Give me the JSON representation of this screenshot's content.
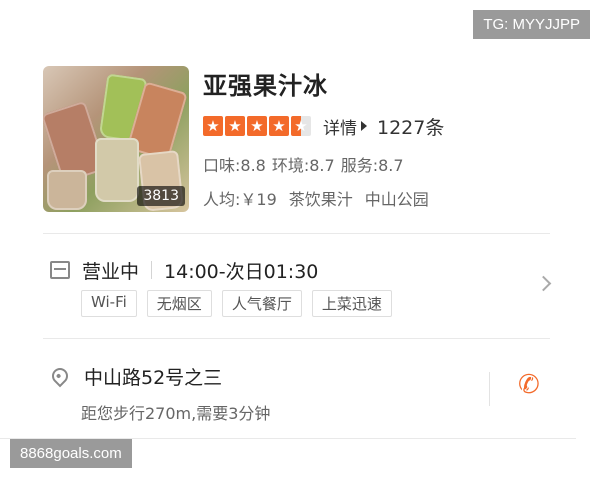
{
  "watermarks": {
    "top": "TG: MYYJJPP",
    "bottom": "8868goals.com"
  },
  "shop": {
    "name": "亚强果汁冰",
    "photo_count": "3813",
    "rating_stars": 4.5,
    "detail_label": "详情",
    "review_count": "1227条",
    "scores": {
      "taste": "口味:8.8",
      "environment": "环境:8.7",
      "service": "服务:8.7"
    },
    "avg_price": "人均:￥19",
    "category": "茶饮果汁",
    "area": "中山公园"
  },
  "hours": {
    "status": "营业中",
    "time": "14:00-次日01:30",
    "tags": [
      "Wi-Fi",
      "无烟区",
      "人气餐厅",
      "上菜迅速"
    ]
  },
  "address": {
    "text": "中山路52号之三",
    "distance": "距您步行270m,需要3分钟"
  },
  "colors": {
    "accent": "#f36a2a"
  },
  "icons": {
    "hours": "calendar-icon",
    "location": "map-pin-icon",
    "phone": "phone-icon",
    "more": "chevron-right-icon"
  }
}
